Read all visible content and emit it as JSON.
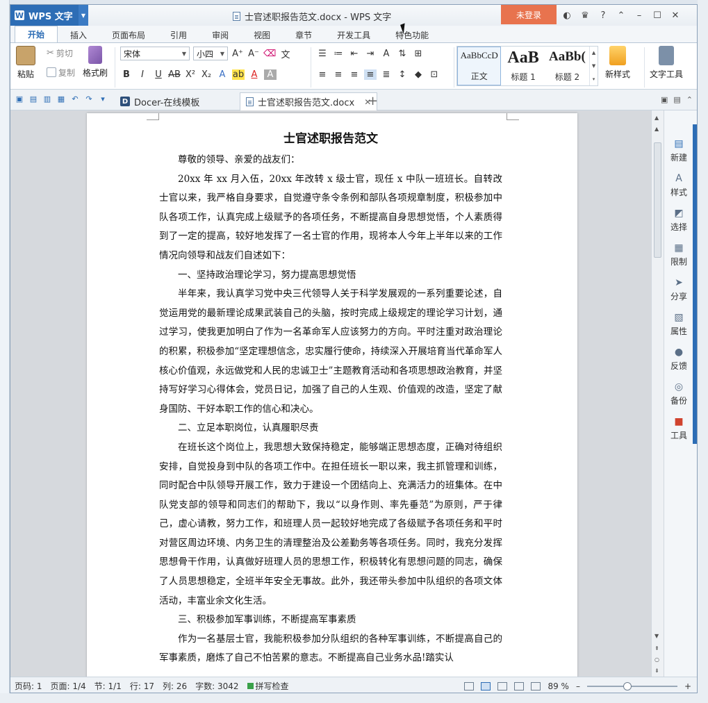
{
  "app": {
    "name": "WPS 文字",
    "logo": "W",
    "window_title": "士官述职报告范文.docx - WPS 文字",
    "login_label": "未登录"
  },
  "ribbon_tabs": [
    "开始",
    "插入",
    "页面布局",
    "引用",
    "审阅",
    "视图",
    "章节",
    "开发工具",
    "特色功能"
  ],
  "clipboard": {
    "paste": "粘贴",
    "cut": "剪切",
    "copy": "复制",
    "format_painter": "格式刷"
  },
  "font": {
    "family": "宋体",
    "size": "小四"
  },
  "styles": [
    {
      "preview": "AaBbCcD",
      "name": "正文"
    },
    {
      "preview": "AaB",
      "name": "标题 1"
    },
    {
      "preview": "AaBb(",
      "name": "标题 2"
    }
  ],
  "new_style_label": "新样式",
  "text_tools_label": "文字工具",
  "doc_tabs": [
    {
      "label": "Docer-在线模板"
    },
    {
      "label": "士官述职报告范文.docx"
    }
  ],
  "document": {
    "title": "士官述职报告范文",
    "paragraphs": [
      "尊敬的领导、亲爱的战友们：",
      "20xx 年 xx 月入伍，20xx 年改转 x 级士官，现任 x 中队一班班长。自转改士官以来，我严格自身要求，自觉遵守条令条例和部队各项规章制度，积极参加中队各项工作，认真完成上级赋予的各项任务，不断提高自身思想觉悟，个人素质得到了一定的提高，较好地发挥了一名士官的作用，现将本人今年上半年以来的工作情况向领导和战友们自述如下：",
      "一、坚持政治理论学习，努力提高思想觉悟",
      "半年来，我认真学习党中央三代领导人关于科学发展观的一系列重要论述，自觉运用党的最新理论成果武装自己的头脑，按时完成上级规定的理论学习计划，通过学习，使我更加明白了作为一名革命军人应该努力的方向。平时注重对政治理论的积累，积极参加“坚定理想信念，忠实履行使命，持续深入开展培育当代革命军人核心价值观，永远做党和人民的忠诚卫士”主题教育活动和各项思想政治教育，并坚持写好学习心得体会，党员日记，加强了自己的人生观、价值观的改造，坚定了献身国防、干好本职工作的信心和决心。",
      "二、立足本职岗位，认真履职尽责",
      "在班长这个岗位上，我思想大致保持稳定，能够端正思想态度，正确对待组织安排，自觉投身到中队的各项工作中。在担任班长一职以来，我主抓管理和训练，同时配合中队领导开展工作，致力于建设一个团结向上、充满活力的班集体。在中队党支部的领导和同志们的帮助下，我以“以身作则、率先垂范”为原则，严于律己，虚心请教，努力工作，和班理人员一起较好地完成了各级赋予各项任务和平时对营区周边环境、内务卫生的清理整治及公差勤务等各项任务。同时，我充分发挥思想骨干作用，认真做好班理人员的思想工作，积极转化有思想问题的同志，确保了人员思想稳定，全班半年安全无事故。此外，我还带头参加中队组织的各项文体活动，丰富业余文化生活。",
      "三、积极参加军事训练，不断提高军事素质",
      "作为一名基层士官，我能积极参加分队组织的各种军事训练，不断提高自己的军事素质，磨炼了自己不怕苦累的意志。不断提高自己业务水品!踏实认"
    ]
  },
  "side_panel": [
    "新建",
    "样式",
    "选择",
    "限制",
    "分享",
    "属性",
    "反馈",
    "备份",
    "工具"
  ],
  "status": {
    "page_num": "页码: 1",
    "pages": "页面: 1/4",
    "section": "节: 1/1",
    "row": "行: 17",
    "col": "列: 26",
    "words": "字数: 3042",
    "spell": "拼写检查",
    "zoom": "89 %",
    "zoom_level": 0.45
  },
  "colors": {
    "brand": "#2d6db5",
    "login": "#e8734e"
  }
}
